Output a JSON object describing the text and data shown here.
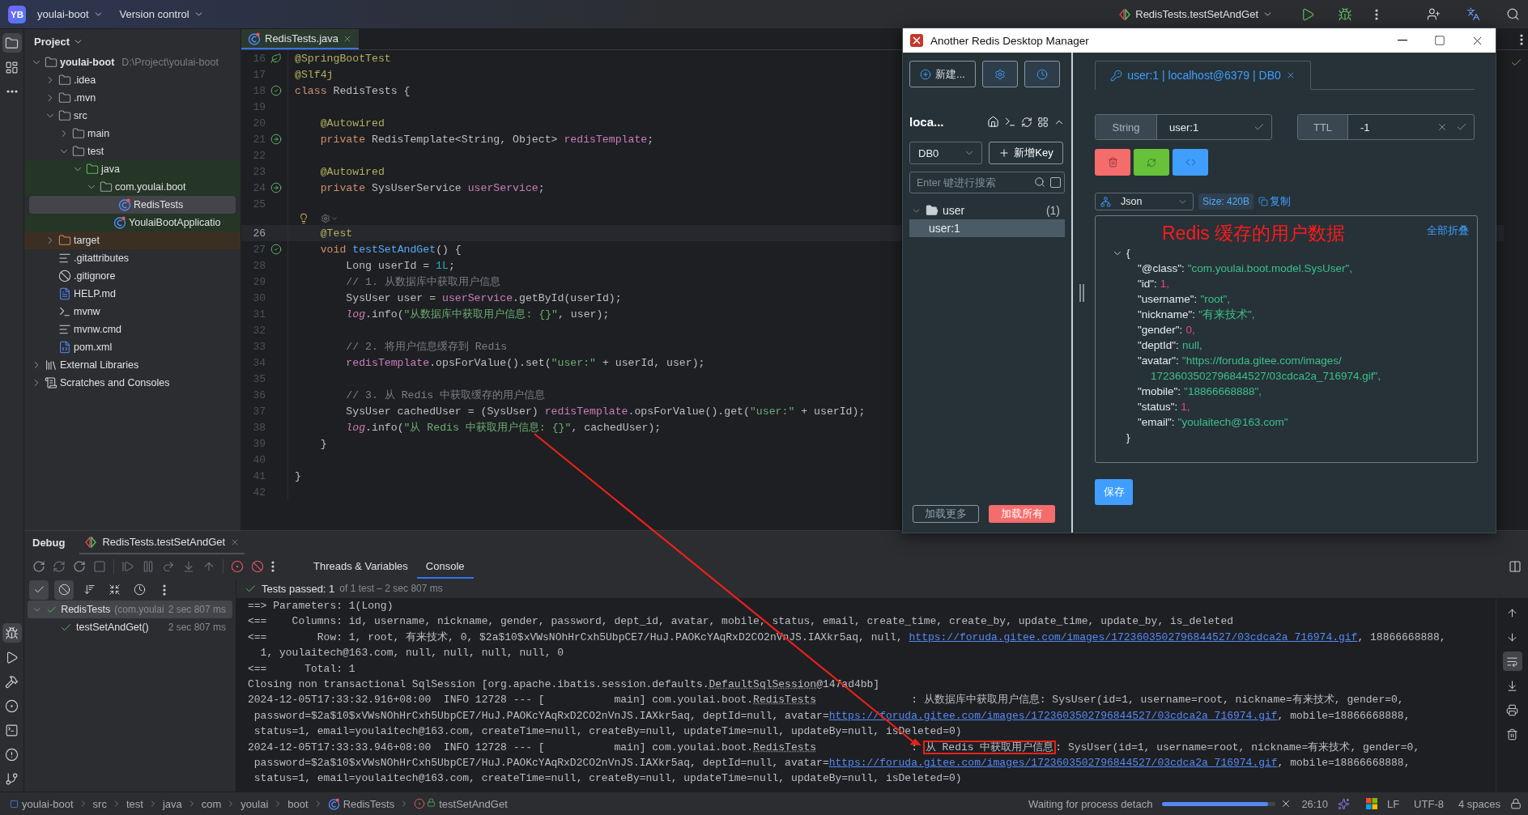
{
  "topbar": {
    "badge": "YB",
    "project": "youlai-boot",
    "vcs": "Version control",
    "run_config": "RedisTests.testSetAndGet"
  },
  "tool_strip": {
    "top": [
      {
        "kind": "project",
        "selected": true
      },
      {
        "kind": "structure",
        "selected": false
      },
      {
        "kind": "more",
        "selected": false
      }
    ],
    "bottom": [
      {
        "kind": "debug",
        "selected": true
      },
      {
        "kind": "run",
        "selected": false
      },
      {
        "kind": "build",
        "selected": false
      },
      {
        "kind": "services",
        "selected": false
      },
      {
        "kind": "terminal",
        "selected": false
      },
      {
        "kind": "problems",
        "selected": false
      },
      {
        "kind": "git",
        "selected": false
      }
    ]
  },
  "project": {
    "title": "Project",
    "tree": [
      {
        "label": "youlai-boot",
        "kind": "module",
        "path": "D:\\Project\\youlai-boot",
        "expanded": true,
        "selected": false,
        "children": [
          {
            "label": ".idea",
            "kind": "folder",
            "expanded": false,
            "selected": false
          },
          {
            "label": ".mvn",
            "kind": "folder",
            "expanded": false,
            "selected": false
          },
          {
            "label": "src",
            "kind": "folder",
            "expanded": true,
            "selected": false,
            "children": [
              {
                "label": "main",
                "kind": "folder",
                "expanded": false,
                "selected": false
              },
              {
                "label": "test",
                "kind": "folder",
                "expanded": true,
                "selected": false,
                "children": [
                  {
                    "label": "java",
                    "kind": "test-root",
                    "expanded": true,
                    "selected": false,
                    "children": [
                      {
                        "label": "com.youlai.boot",
                        "kind": "package",
                        "expanded": true,
                        "selected": false,
                        "children": [
                          {
                            "label": "RedisTests",
                            "kind": "class",
                            "selected": true
                          },
                          {
                            "label": "YoulaiBootApplicatio",
                            "kind": "class",
                            "selected": false
                          }
                        ]
                      }
                    ]
                  }
                ]
              }
            ]
          },
          {
            "label": "target",
            "kind": "excluded",
            "expanded": false,
            "selected": false
          },
          {
            "label": ".gitattributes",
            "kind": "text",
            "selected": false
          },
          {
            "label": ".gitignore",
            "kind": "ignore",
            "selected": false
          },
          {
            "label": "HELP.md",
            "kind": "markdown",
            "selected": false
          },
          {
            "label": "mvnw",
            "kind": "shell",
            "selected": false
          },
          {
            "label": "mvnw.cmd",
            "kind": "text",
            "selected": false
          },
          {
            "label": "pom.xml",
            "kind": "maven",
            "selected": false
          }
        ]
      },
      {
        "label": "External Libraries",
        "kind": "libraries",
        "expanded": false,
        "selected": false
      },
      {
        "label": "Scratches and Consoles",
        "kind": "scratches",
        "expanded": false,
        "selected": false
      }
    ]
  },
  "editor": {
    "tab": {
      "label": "RedisTests.java",
      "selected": true
    },
    "lines": [
      {
        "kind": "code",
        "number": "16",
        "marker": {
          "kind": "spring"
        },
        "current": false,
        "tokens": [
          {
            "kind": "annotation",
            "text": "@SpringBootTest"
          }
        ]
      },
      {
        "kind": "code",
        "number": "17",
        "current": false,
        "tokens": [
          {
            "kind": "annotation",
            "text": "@Slf4j"
          }
        ]
      },
      {
        "kind": "code",
        "number": "18",
        "marker": {
          "kind": "run"
        },
        "current": false,
        "tokens": [
          {
            "kind": "keyword",
            "text": "class "
          },
          {
            "kind": "plain",
            "text": "RedisTests {"
          }
        ]
      },
      {
        "kind": "code",
        "number": "19",
        "current": false
      },
      {
        "kind": "code",
        "number": "20",
        "current": false,
        "tokens": [
          {
            "kind": "annotation",
            "text": "    @Autowired"
          }
        ]
      },
      {
        "kind": "code",
        "number": "21",
        "marker": {
          "kind": "bean"
        },
        "current": false,
        "tokens": [
          {
            "kind": "keyword",
            "text": "    private "
          },
          {
            "kind": "plain",
            "text": "RedisTemplate<String, Object> "
          },
          {
            "kind": "field",
            "text": "redisTemplate"
          },
          {
            "kind": "plain",
            "text": ";"
          }
        ]
      },
      {
        "kind": "code",
        "number": "22",
        "current": false
      },
      {
        "kind": "code",
        "number": "23",
        "current": false,
        "tokens": [
          {
            "kind": "annotation",
            "text": "    @Autowired"
          }
        ]
      },
      {
        "kind": "code",
        "number": "24",
        "marker": {
          "kind": "bean"
        },
        "current": false,
        "tokens": [
          {
            "kind": "keyword",
            "text": "    private "
          },
          {
            "kind": "plain",
            "text": "SysUserService "
          },
          {
            "kind": "field",
            "text": "userService"
          },
          {
            "kind": "plain",
            "text": ";"
          }
        ]
      },
      {
        "kind": "code",
        "number": "25",
        "current": false
      },
      {
        "kind": "inlay"
      },
      {
        "kind": "code",
        "number": "26",
        "current": true,
        "tokens": [
          {
            "kind": "annotation",
            "text": "    @Test"
          }
        ]
      },
      {
        "kind": "code",
        "number": "27",
        "marker": {
          "kind": "run"
        },
        "current": false,
        "tokens": [
          {
            "kind": "keyword",
            "text": "    void "
          },
          {
            "kind": "method",
            "text": "testSetAndGet"
          },
          {
            "kind": "plain",
            "text": "() {"
          }
        ]
      },
      {
        "kind": "code",
        "number": "28",
        "current": false,
        "tokens": [
          {
            "kind": "plain",
            "text": "        Long userId = "
          },
          {
            "kind": "number",
            "text": "1L"
          },
          {
            "kind": "plain",
            "text": ";"
          }
        ]
      },
      {
        "kind": "code",
        "number": "29",
        "current": false,
        "tokens": [
          {
            "kind": "comment",
            "text": "        // 1. 从数据库中获取用户信息"
          }
        ]
      },
      {
        "kind": "code",
        "number": "30",
        "current": false,
        "tokens": [
          {
            "kind": "plain",
            "text": "        SysUser user = "
          },
          {
            "kind": "field",
            "text": "userService"
          },
          {
            "kind": "plain",
            "text": ".getById(userId);"
          }
        ]
      },
      {
        "kind": "code",
        "number": "31",
        "current": false,
        "tokens": [
          {
            "kind": "log",
            "text": "        log"
          },
          {
            "kind": "plain",
            "text": ".info("
          },
          {
            "kind": "string",
            "text": "\"从数据库中获取用户信息: {}\""
          },
          {
            "kind": "plain",
            "text": ", user);"
          }
        ]
      },
      {
        "kind": "code",
        "number": "32",
        "current": false
      },
      {
        "kind": "code",
        "number": "33",
        "current": false,
        "tokens": [
          {
            "kind": "comment",
            "text": "        // 2. 将用户信息缓存到 Redis"
          }
        ]
      },
      {
        "kind": "code",
        "number": "34",
        "current": false,
        "tokens": [
          {
            "kind": "field",
            "text": "        redisTemplate"
          },
          {
            "kind": "plain",
            "text": ".opsForValue().set("
          },
          {
            "kind": "string",
            "text": "\"user:\""
          },
          {
            "kind": "plain",
            "text": " + userId, user);"
          }
        ]
      },
      {
        "kind": "code",
        "number": "35",
        "current": false
      },
      {
        "kind": "code",
        "number": "36",
        "current": false,
        "tokens": [
          {
            "kind": "comment",
            "text": "        // 3. 从 Redis 中获取缓存的用户信息"
          }
        ]
      },
      {
        "kind": "code",
        "number": "37",
        "current": false,
        "tokens": [
          {
            "kind": "plain",
            "text": "        SysUser cachedUser = (SysUser) "
          },
          {
            "kind": "field",
            "text": "redisTemplate"
          },
          {
            "kind": "plain",
            "text": ".opsForValue().get("
          },
          {
            "kind": "string",
            "text": "\"user:\""
          },
          {
            "kind": "plain",
            "text": " + userId);"
          }
        ]
      },
      {
        "kind": "code",
        "number": "38",
        "current": false,
        "tokens": [
          {
            "kind": "log",
            "text": "        log"
          },
          {
            "kind": "plain",
            "text": ".info("
          },
          {
            "kind": "string",
            "text": "\"从 Redis 中获取用户信息: {}\""
          },
          {
            "kind": "plain",
            "text": ", cachedUser);"
          }
        ]
      },
      {
        "kind": "code",
        "number": "39",
        "current": false,
        "tokens": [
          {
            "kind": "plain",
            "text": "    }"
          }
        ]
      },
      {
        "kind": "code",
        "number": "40",
        "current": false
      },
      {
        "kind": "code",
        "number": "41",
        "current": false,
        "tokens": [
          {
            "kind": "plain",
            "text": "}"
          }
        ]
      },
      {
        "kind": "code",
        "number": "42",
        "current": false
      }
    ]
  },
  "debug": {
    "title": "Debug",
    "session_tab": "RedisTests.testSetAndGet",
    "tabs": [
      {
        "label": "Threads & Variables",
        "selected": false
      },
      {
        "label": "Console",
        "selected": true
      }
    ],
    "test_tools": [
      {
        "kind": "show-passed",
        "selected": true
      },
      {
        "kind": "show-ignored",
        "selected": true
      },
      {
        "kind": "sort",
        "selected": false
      },
      {
        "kind": "collapse",
        "selected": false
      },
      {
        "kind": "duration",
        "selected": false
      },
      {
        "kind": "more",
        "selected": false
      }
    ],
    "tests": [
      {
        "label": "RedisTests",
        "detail": "(com.youlai",
        "time": "2 sec 807 ms",
        "passed": true,
        "expanded": true,
        "selected": true,
        "children": [
          {
            "label": "testSetAndGet()",
            "time": "2 sec 807 ms",
            "passed": true,
            "selected": false
          }
        ]
      }
    ],
    "result": {
      "main": "Tests passed: 1",
      "detail": "of 1 test – 2 sec 807 ms"
    },
    "console_tools": [
      {
        "kind": "up",
        "selected": false
      },
      {
        "kind": "down",
        "selected": false
      },
      {
        "kind": "wrap",
        "selected": true
      },
      {
        "kind": "scroll-end",
        "selected": false
      },
      {
        "kind": "print",
        "selected": false
      },
      {
        "kind": "clear",
        "selected": false
      }
    ],
    "console": [
      {
        "segments": [
          {
            "kind": "text",
            "text": "==> Parameters: 1(Long)"
          }
        ]
      },
      {
        "segments": [
          {
            "kind": "text",
            "text": "<==    Columns: id, username, nickname, gender, password, dept_id, avatar, mobile, status, email, create_time, create_by, update_time, update_by, is_deleted"
          }
        ]
      },
      {
        "segments": [
          {
            "kind": "text",
            "text": "<==        Row: 1, root, 有来技术, 0, $2a$10$xVWsNOhHrCxh5UbpCE7/HuJ.PAOKcYAqRxD2CO2nVnJS.IAXkr5aq, null, "
          },
          {
            "kind": "link",
            "text": "https://foruda.gitee.com/images/1723603502796844527/03cdca2a_716974.gif"
          },
          {
            "kind": "text",
            "text": ", 18866668888,"
          }
        ]
      },
      {
        "segments": [
          {
            "kind": "text",
            "text": "  1, youlaitech@163.com, null, null, null, null, 0"
          }
        ]
      },
      {
        "segments": [
          {
            "kind": "text",
            "text": "<==      Total: 1"
          }
        ]
      },
      {
        "segments": [
          {
            "kind": "text",
            "text": "Closing non transactional SqlSession [org.apache.ibatis.session.defaults."
          },
          {
            "kind": "dotted",
            "text": "DefaultSqlSession"
          },
          {
            "kind": "text",
            "text": "@147ad4bb]"
          }
        ]
      },
      {
        "segments": [
          {
            "kind": "text",
            "text": "2024-12-05T17:33:32.916+08:00  INFO 12728 --- [           main] com.youlai.boot."
          },
          {
            "kind": "dotted",
            "text": "RedisTests"
          },
          {
            "kind": "text",
            "text": "               : 从数据库中获取用户信息: SysUser(id=1, username=root, nickname=有来技术, gender=0,"
          }
        ]
      },
      {
        "segments": [
          {
            "kind": "text",
            "text": " password=$2a$10$xVWsNOhHrCxh5UbpCE7/HuJ.PAOKcYAqRxD2CO2nVnJS.IAXkr5aq, deptId=null, avatar="
          },
          {
            "kind": "link",
            "text": "https://foruda.gitee.com/images/1723603502796844527/03cdca2a_716974.gif"
          },
          {
            "kind": "text",
            "text": ", mobile=18866668888,"
          }
        ]
      },
      {
        "segments": [
          {
            "kind": "text",
            "text": " status=1, email=youlaitech@163.com, createTime=null, createBy=null, updateTime=null, updateBy=null, isDeleted=0)"
          }
        ]
      },
      {
        "segments": [
          {
            "kind": "text",
            "text": "2024-12-05T17:33:33.946+08:00  INFO 12728 --- [           main] com.youlai.boot."
          },
          {
            "kind": "dotted",
            "text": "RedisTests"
          },
          {
            "kind": "text",
            "text": "               : "
          },
          {
            "kind": "boxed",
            "text": "从 Redis 中获取用户信息"
          },
          {
            "kind": "text",
            "text": ": SysUser(id=1, username=root, nickname=有来技术, gender=0,"
          }
        ]
      },
      {
        "segments": [
          {
            "kind": "text",
            "text": " password=$2a$10$xVWsNOhHrCxh5UbpCE7/HuJ.PAOKcYAqRxD2CO2nVnJS.IAXkr5aq, deptId=null, avatar="
          },
          {
            "kind": "link",
            "text": "https://foruda.gitee.com/images/1723603502796844527/03cdca2a_716974.gif"
          },
          {
            "kind": "text",
            "text": ", mobile=18866668888,"
          }
        ]
      },
      {
        "segments": [
          {
            "kind": "text",
            "text": " status=1, email=youlaitech@163.com, createTime=null, createBy=null, updateTime=null, updateBy=null, isDeleted=0)"
          }
        ]
      }
    ]
  },
  "status_bar": {
    "breadcrumbs": [
      {
        "label": "youlai-boot",
        "kind": "module"
      },
      {
        "label": "src",
        "kind": "plain"
      },
      {
        "label": "test",
        "kind": "plain"
      },
      {
        "label": "java",
        "kind": "plain"
      },
      {
        "label": "com",
        "kind": "plain"
      },
      {
        "label": "youlai",
        "kind": "plain"
      },
      {
        "label": "boot",
        "kind": "plain"
      },
      {
        "label": "RedisTests",
        "kind": "class"
      },
      {
        "label": "testSetAndGet",
        "kind": "method"
      }
    ],
    "process": {
      "label": "Waiting for process detach",
      "level": 0.93
    },
    "position": "26:10",
    "line_separator": "LF",
    "encoding": "UTF-8",
    "indent": "4 spaces"
  },
  "redis": {
    "title": "Another Redis Desktop Manager",
    "new_button": "新建...",
    "connection": "loca...",
    "db": "DB0",
    "add_key": "新增Key",
    "search": {
      "placeholder": "Enter 键进行搜索",
      "checked": false
    },
    "keys": [
      {
        "label": "user",
        "count": "(1)",
        "expanded": true,
        "selected": false,
        "children": [
          {
            "label": "user:1",
            "selected": true
          }
        ]
      }
    ],
    "load_more": "加载更多",
    "load_all": "加载所有",
    "tab": {
      "label": "user:1 | localhost@6379 | DB0",
      "selected": true
    },
    "type": "String",
    "key": "user:1",
    "ttl_label": "TTL",
    "ttl": "-1",
    "format": "Json",
    "size": "Size: 420B",
    "copy": "复制",
    "collapse_all": "全部折叠",
    "annotation": "Redis 缓存的用户数据",
    "json": {
      "open": "{",
      "close": "}",
      "entries": [
        {
          "key": "\"@class\":",
          "value": "\"com.youlai.boot.model.SysUser\",",
          "kind": "string"
        },
        {
          "key": "\"id\":",
          "value": "1,",
          "kind": "number"
        },
        {
          "key": "\"username\":",
          "value": "\"root\",",
          "kind": "string"
        },
        {
          "key": "\"nickname\":",
          "value": "\"有来技术\",",
          "kind": "string"
        },
        {
          "key": "\"gender\":",
          "value": "0,",
          "kind": "number"
        },
        {
          "key": "\"deptId\":",
          "value": "null,",
          "kind": "null"
        },
        {
          "key": "\"avatar\":",
          "value": "\"https://foruda.gitee.com/images/",
          "continuation": "1723603502796844527/03cdca2a_716974.gif\",",
          "kind": "string"
        },
        {
          "key": "\"mobile\":",
          "value": "\"18866668888\",",
          "kind": "string"
        },
        {
          "key": "\"status\":",
          "value": "1,",
          "kind": "number"
        },
        {
          "key": "\"email\":",
          "value": "\"youlaitech@163.com\"",
          "kind": "string"
        }
      ]
    },
    "save": "保存"
  }
}
